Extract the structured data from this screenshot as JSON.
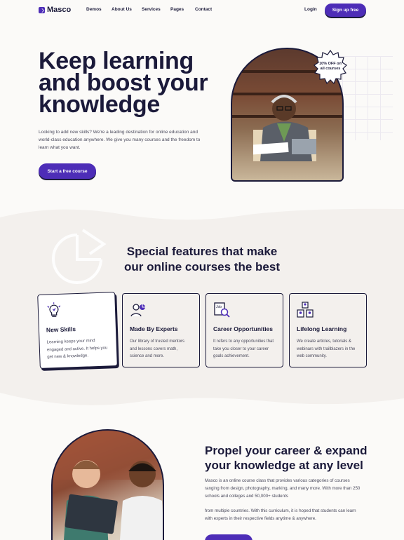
{
  "header": {
    "brand": "Masco",
    "menu": [
      "Demos",
      "About Us",
      "Services",
      "Pages",
      "Contact"
    ],
    "login": "Login",
    "signup": "Sign up free"
  },
  "hero": {
    "title": "Keep learning and boost your knowledge",
    "description": "Looking to add new skills? We're a leading destination for online education and world-class education anywhere. We give you many courses and the freedom to learn what you want.",
    "cta": "Start a free course",
    "badge_line1": "10% OFF on",
    "badge_line2": "all courses"
  },
  "features": {
    "title_line1": "Special features that make",
    "title_line2": "our online courses the best",
    "cards": [
      {
        "title": "New Skills",
        "text": "Learning keeps your mind engaged and active. It helps you get new & knowledge.",
        "icon": "lightbulb-icon"
      },
      {
        "title": "Made By Experts",
        "text": "Our library of trusted mentors and lessons covers math, science and more.",
        "icon": "expert-icon"
      },
      {
        "title": "Career Opportunities",
        "text": "It refers to any opportunities that take you closer to your career goals achievement.",
        "icon": "job-search-icon"
      },
      {
        "title": "Lifelong Learning",
        "text": "We create articles, tutorials & webinars with trailblazers in the web community.",
        "icon": "team-icon"
      }
    ]
  },
  "about": {
    "title": "Propel your career & expand your knowledge at any level",
    "para1": "Masco is an online course class that provides various categories of courses ranging from design, photography, marking, and many more. With more than 250 schools and colleges and 50,000+ students",
    "para2": "from multiple countries. With this curriculum, it is hoped that students can learn with experts in their respective fields anytime & anywhere."
  },
  "colors": {
    "primary": "#4d2db7",
    "ink": "#1b1a3a",
    "band": "#f3f0ed",
    "background": "#fbfaf8"
  }
}
